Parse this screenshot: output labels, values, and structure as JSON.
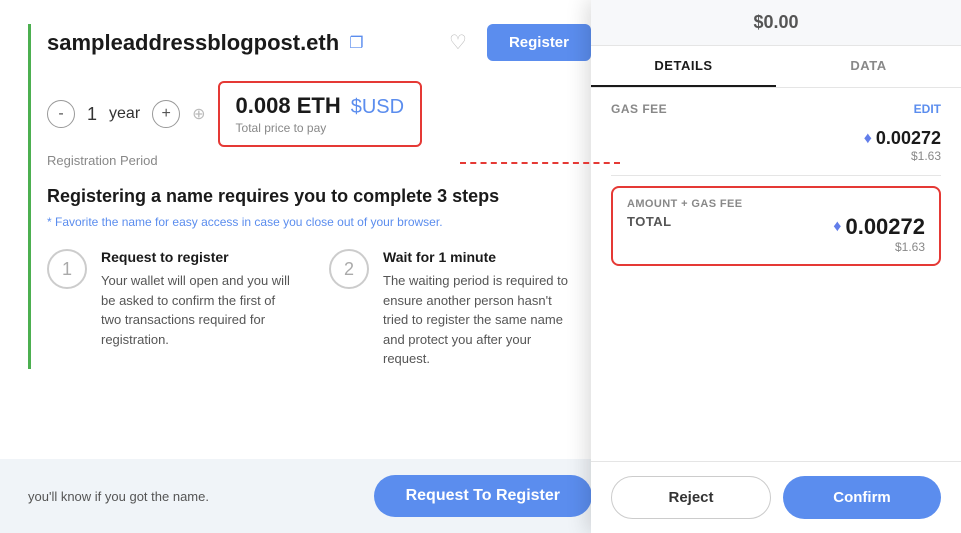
{
  "main": {
    "title": "sampleaddressblogpost.eth",
    "register_button": "Register",
    "period": {
      "count": "1",
      "unit": "year",
      "minus_label": "-",
      "plus_label": "+",
      "period_label": "Registration Period"
    },
    "price": {
      "eth": "0.008 ETH",
      "usd": "$USD",
      "total_label": "Total price to pay"
    },
    "steps_title": "Registering a name requires you to complete 3 steps",
    "fav_note": "* Favorite the name for easy access in case you close out of your browser.",
    "steps": [
      {
        "number": "1",
        "title": "Request to register",
        "description": "Your wallet will open and you will be asked to confirm the first of two transactions required for registration."
      },
      {
        "number": "2",
        "title": "Wait for 1 minute",
        "description": "The waiting period is required to ensure another person hasn't tried to register the same name and protect you after your request."
      }
    ],
    "bottom_text": "you'll know if you got the name.",
    "request_register_btn": "Request To Register"
  },
  "metamask": {
    "top_amount": "$0.00",
    "tabs": [
      "DETAILS",
      "DATA"
    ],
    "active_tab": "DETAILS",
    "edit_label": "EDIT",
    "gas_fee_label": "GAS FEE",
    "gas_eth": "0.00272",
    "gas_usd": "$1.63",
    "total_label": "TOTAL",
    "amount_gas_label": "AMOUNT + GAS FEE",
    "total_eth": "0.00272",
    "total_usd": "$1.63",
    "reject_btn": "Reject",
    "confirm_btn": "Confirm"
  }
}
